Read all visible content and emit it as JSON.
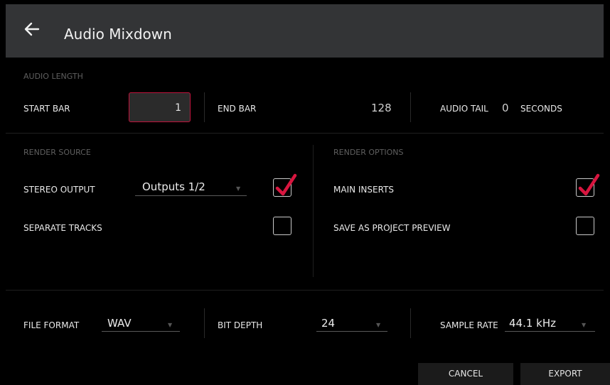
{
  "header": {
    "title": "Audio Mixdown",
    "back_icon": "back-arrow-icon"
  },
  "audio_length": {
    "section_label": "AUDIO LENGTH",
    "start_bar_label": "START BAR",
    "start_bar_value": "1",
    "end_bar_label": "END BAR",
    "end_bar_value": "128",
    "audio_tail_label": "AUDIO TAIL",
    "audio_tail_value": "0",
    "audio_tail_unit": "SECONDS"
  },
  "render_source": {
    "section_label": "RENDER SOURCE",
    "stereo_output_label": "STEREO OUTPUT",
    "stereo_output_value": "Outputs 1/2",
    "stereo_output_checked": true,
    "separate_tracks_label": "SEPARATE TRACKS",
    "separate_tracks_checked": false
  },
  "render_options": {
    "section_label": "RENDER OPTIONS",
    "main_inserts_label": "MAIN INSERTS",
    "main_inserts_checked": true,
    "save_preview_label": "SAVE AS PROJECT PREVIEW",
    "save_preview_checked": false
  },
  "format": {
    "file_format_label": "FILE FORMAT",
    "file_format_value": "WAV",
    "bit_depth_label": "BIT DEPTH",
    "bit_depth_value": "24",
    "sample_rate_label": "SAMPLE RATE",
    "sample_rate_value": "44.1 kHz"
  },
  "buttons": {
    "cancel": "CANCEL",
    "export": "EXPORT"
  },
  "colors": {
    "accent": "#d8163f",
    "header_bg": "#333436",
    "bg": "#000000"
  }
}
